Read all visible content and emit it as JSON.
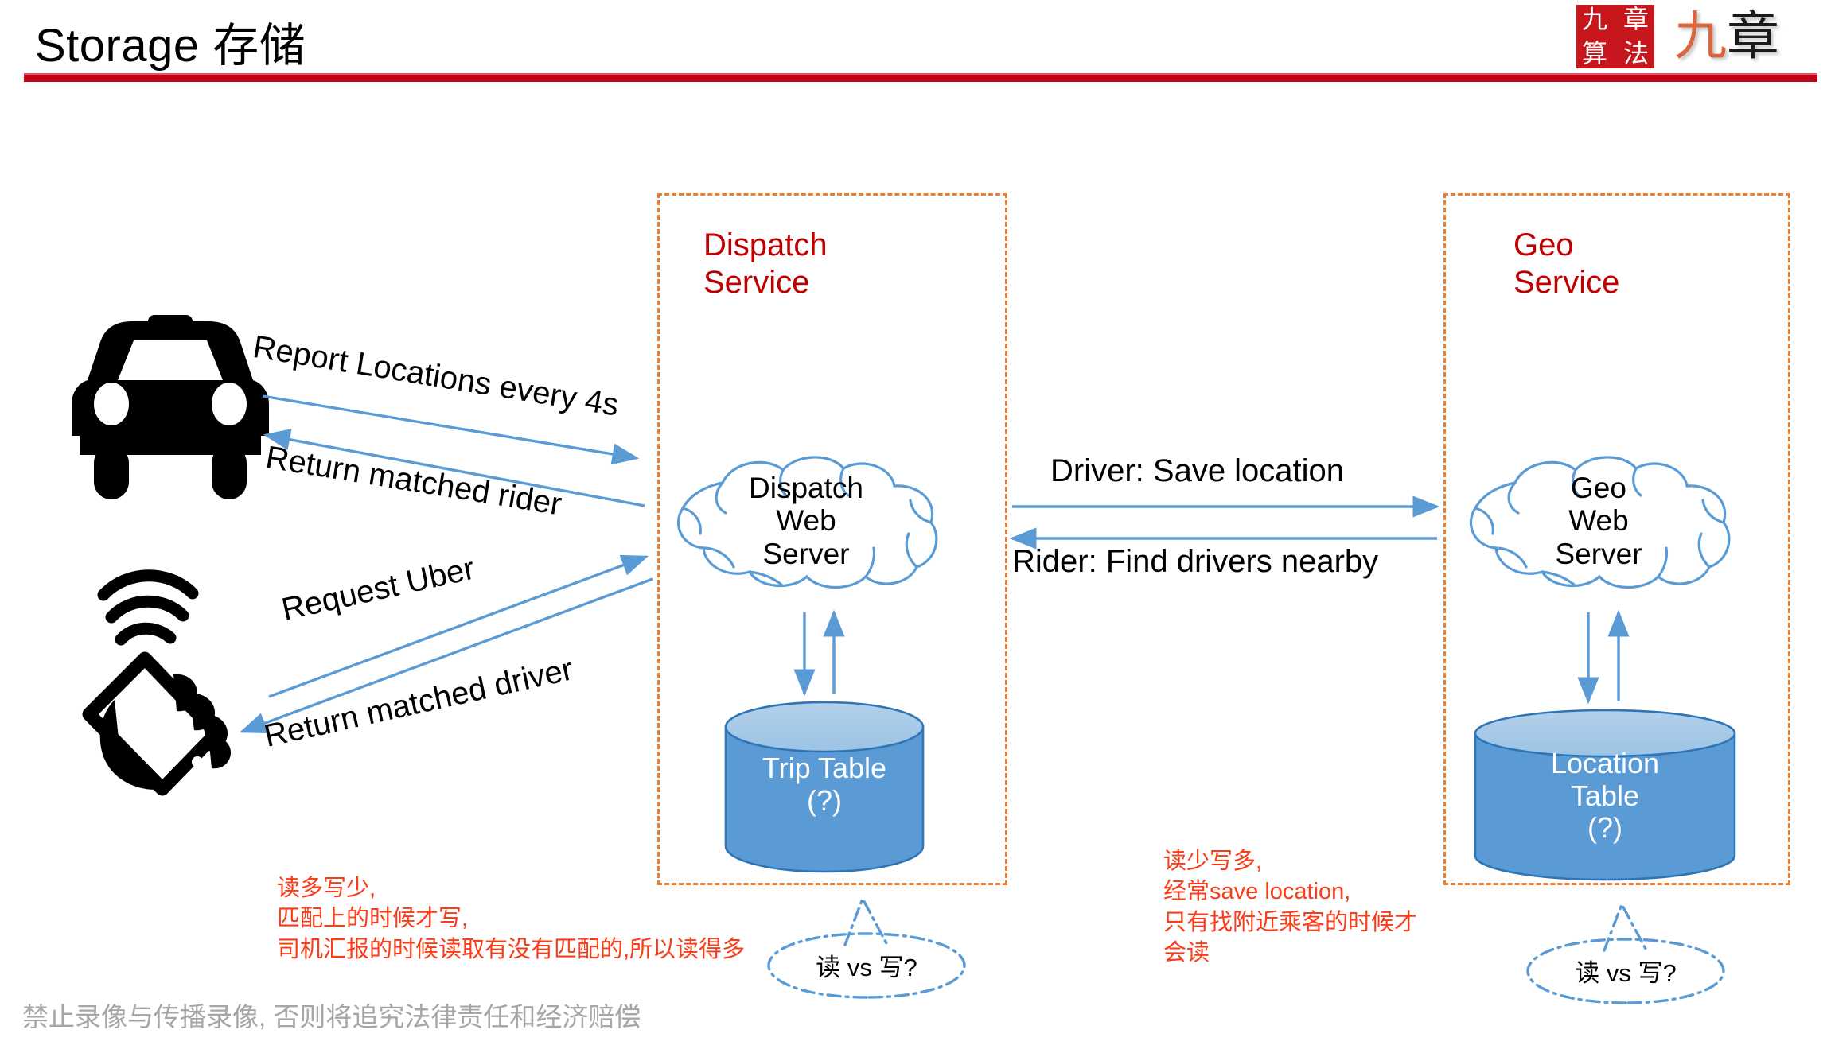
{
  "slide": {
    "title": "Storage 存储",
    "footer_note": "禁止录像与传播录像, 否则将追究法律责任和经济赔偿"
  },
  "logo": {
    "seal_chars": [
      "九",
      "章",
      "算",
      "法"
    ],
    "brush_char_1": "九",
    "brush_char_2": "章",
    "seal_color": "#c8161d",
    "brush_accent_color": "#d9663f"
  },
  "colors": {
    "title_rule": "#c00418",
    "service_box_border": "#ed7d31",
    "service_title": "#c00000",
    "arrow_blue": "#5b9bd5",
    "cloud_outline": "#5b9bd5",
    "cylinder_fill": "#5b9bd5",
    "note_red": "#fa3c17",
    "footer_gray": "#a6a6a6"
  },
  "actors": {
    "taxi_icon": "taxi-car-icon",
    "phone_icon": "hand-holding-phone-icon"
  },
  "dispatch_service": {
    "title": "Dispatch\nService",
    "cloud_label": "Dispatch\nWeb\nServer",
    "db_label": "Trip Table\n(?)",
    "callout": "读 vs 写?",
    "note": "读多写少,\n匹配上的时候才写,\n司机汇报的时候读取有没有匹配的,所以读得多"
  },
  "geo_service": {
    "title": "Geo\nService",
    "cloud_label": "Geo\nWeb\nServer",
    "db_label": "Location\nTable\n(?)",
    "callout": "读 vs 写?",
    "note": "读少写多,\n经常save location,\n只有找附近乘客的时候才\n会读"
  },
  "edges": {
    "report_locations": "Report Locations every 4s",
    "return_matched_rider": "Return matched rider",
    "request_uber": "Request Uber",
    "return_matched_driver": "Return matched driver",
    "driver_save_location": "Driver: Save location",
    "rider_find_drivers": "Rider: Find drivers nearby"
  }
}
